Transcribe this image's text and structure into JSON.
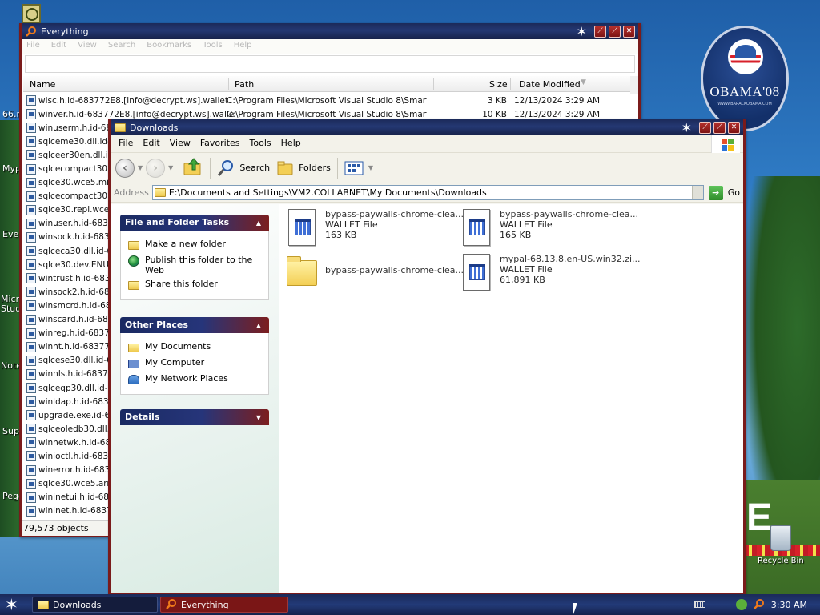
{
  "desktop": {
    "badge_title": "OBAMA'08",
    "badge_sub": "WWW.BARACKOBAMA.COM",
    "labels": [
      "66.m",
      "Mypa",
      "Ever",
      "Micro Studi",
      "Note",
      "Supe",
      "Pego"
    ],
    "recycle_bin": "Recycle Bin",
    "white_letter": "E"
  },
  "everything": {
    "title": "Everything",
    "menu": [
      "File",
      "Edit",
      "View",
      "Search",
      "Bookmarks",
      "Tools",
      "Help"
    ],
    "search_value": "",
    "columns": {
      "name": "Name",
      "path": "Path",
      "size": "Size",
      "date": "Date Modified"
    },
    "rows": [
      {
        "name": "wisc.h.id-683772E8.[info@decrypt.ws].wallet",
        "path": "C:\\Program Files\\Microsoft Visual Studio 8\\Smart...",
        "size": "3 KB",
        "date": "12/13/2024 3:29 AM"
      },
      {
        "name": "winver.h.id-683772E8.[info@decrypt.ws].wallet",
        "path": "C:\\Program Files\\Microsoft Visual Studio 8\\Smart...",
        "size": "10 KB",
        "date": "12/13/2024 3:29 AM"
      },
      {
        "name": "winuserm.h.id-683",
        "path": "",
        "size": "",
        "date": ""
      },
      {
        "name": "sqlceme30.dll.id-6",
        "path": "",
        "size": "",
        "date": ""
      },
      {
        "name": "sqlceer30en.dll.id",
        "path": "",
        "size": "",
        "date": ""
      },
      {
        "name": "sqlcecompact30.dl",
        "path": "",
        "size": "",
        "date": ""
      },
      {
        "name": "sqlce30.wce5.mips",
        "path": "",
        "size": "",
        "date": ""
      },
      {
        "name": "sqlcecompact30.dl",
        "path": "",
        "size": "",
        "date": ""
      },
      {
        "name": "sqlce30.repl.wce5",
        "path": "",
        "size": "",
        "date": ""
      },
      {
        "name": "winuser.h.id-6837",
        "path": "",
        "size": "",
        "date": ""
      },
      {
        "name": "winsock.h.id-6837",
        "path": "",
        "size": "",
        "date": ""
      },
      {
        "name": "sqlceca30.dll.id-6",
        "path": "",
        "size": "",
        "date": ""
      },
      {
        "name": "sqlce30.dev.ENU.",
        "path": "",
        "size": "",
        "date": ""
      },
      {
        "name": "wintrust.h.id-6837",
        "path": "",
        "size": "",
        "date": ""
      },
      {
        "name": "winsock2.h.id-683",
        "path": "",
        "size": "",
        "date": ""
      },
      {
        "name": "winsmcrd.h.id-683",
        "path": "",
        "size": "",
        "date": ""
      },
      {
        "name": "winscard.h.id-6831",
        "path": "",
        "size": "",
        "date": ""
      },
      {
        "name": "winreg.h.id-68377",
        "path": "",
        "size": "",
        "date": ""
      },
      {
        "name": "winnt.h.id-683772",
        "path": "",
        "size": "",
        "date": ""
      },
      {
        "name": "sqlcese30.dll.id-68",
        "path": "",
        "size": "",
        "date": ""
      },
      {
        "name": "winnls.h.id-683772",
        "path": "",
        "size": "",
        "date": ""
      },
      {
        "name": "sqlceqp30.dll.id-68",
        "path": "",
        "size": "",
        "date": ""
      },
      {
        "name": "winldap.h.id-68377",
        "path": "",
        "size": "",
        "date": ""
      },
      {
        "name": "upgrade.exe.id-68",
        "path": "",
        "size": "",
        "date": ""
      },
      {
        "name": "sqlceoledb30.dll.i",
        "path": "",
        "size": "",
        "date": ""
      },
      {
        "name": "winnetwk.h.id-683",
        "path": "",
        "size": "",
        "date": ""
      },
      {
        "name": "winioctl.h.id-68377",
        "path": "",
        "size": "",
        "date": ""
      },
      {
        "name": "winerror.h.id-6837",
        "path": "",
        "size": "",
        "date": ""
      },
      {
        "name": "sqlce30.wce5.arm",
        "path": "",
        "size": "",
        "date": ""
      },
      {
        "name": "wininetui.h.id-6831",
        "path": "",
        "size": "",
        "date": ""
      },
      {
        "name": "wininet.h.id-68377",
        "path": "",
        "size": "",
        "date": ""
      }
    ],
    "status": "79,573 objects"
  },
  "downloads": {
    "title": "Downloads",
    "menu": [
      "File",
      "Edit",
      "View",
      "Favorites",
      "Tools",
      "Help"
    ],
    "toolbar": {
      "search": "Search",
      "folders": "Folders"
    },
    "address_label": "Address",
    "address_value": "E:\\Documents and Settings\\VM2.COLLABNET\\My Documents\\Downloads",
    "go_label": "Go",
    "tasks": {
      "file_folder_title": "File and Folder Tasks",
      "file_folder_items": [
        "Make a new folder",
        "Publish this folder to the Web",
        "Share this folder"
      ],
      "other_places_title": "Other Places",
      "other_places_items": [
        "My Documents",
        "My Computer",
        "My Network Places"
      ],
      "details_title": "Details"
    },
    "files": [
      {
        "name": "bypass-paywalls-chrome-clea...",
        "type": "WALLET File",
        "size": "163 KB",
        "kind": "doc"
      },
      {
        "name": "bypass-paywalls-chrome-clea...",
        "type": "WALLET File",
        "size": "165 KB",
        "kind": "doc"
      },
      {
        "name": "bypass-paywalls-chrome-clea...",
        "type": "",
        "size": "",
        "kind": "folder"
      },
      {
        "name": "mypal-68.13.8.en-US.win32.zi...",
        "type": "WALLET File",
        "size": "61,891 KB",
        "kind": "doc"
      }
    ]
  },
  "taskbar": {
    "items": [
      {
        "label": "Downloads",
        "icon": "folder-icon"
      },
      {
        "label": "Everything",
        "icon": "search-icon"
      }
    ],
    "clock": "3:30 AM"
  }
}
